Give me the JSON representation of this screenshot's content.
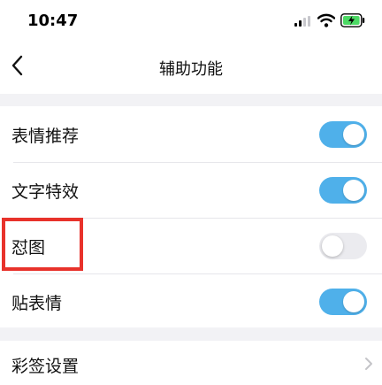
{
  "status_bar": {
    "time": "10:47",
    "icons": [
      "signal-icon",
      "wifi-icon",
      "battery-charging-icon"
    ]
  },
  "nav": {
    "back_icon": "chevron-left-icon",
    "title": "辅助功能"
  },
  "settings": [
    {
      "label": "表情推荐",
      "enabled": true
    },
    {
      "label": "文字特效",
      "enabled": true
    },
    {
      "label": "怼图",
      "enabled": false
    },
    {
      "label": "贴表情",
      "enabled": true
    }
  ],
  "more": {
    "label": "彩签设置",
    "icon": "chevron-right-icon"
  },
  "colors": {
    "toggle_on": "#4fb0ea",
    "toggle_off": "#ebebef",
    "highlight": "#e8322b",
    "battery": "#4cd964"
  }
}
